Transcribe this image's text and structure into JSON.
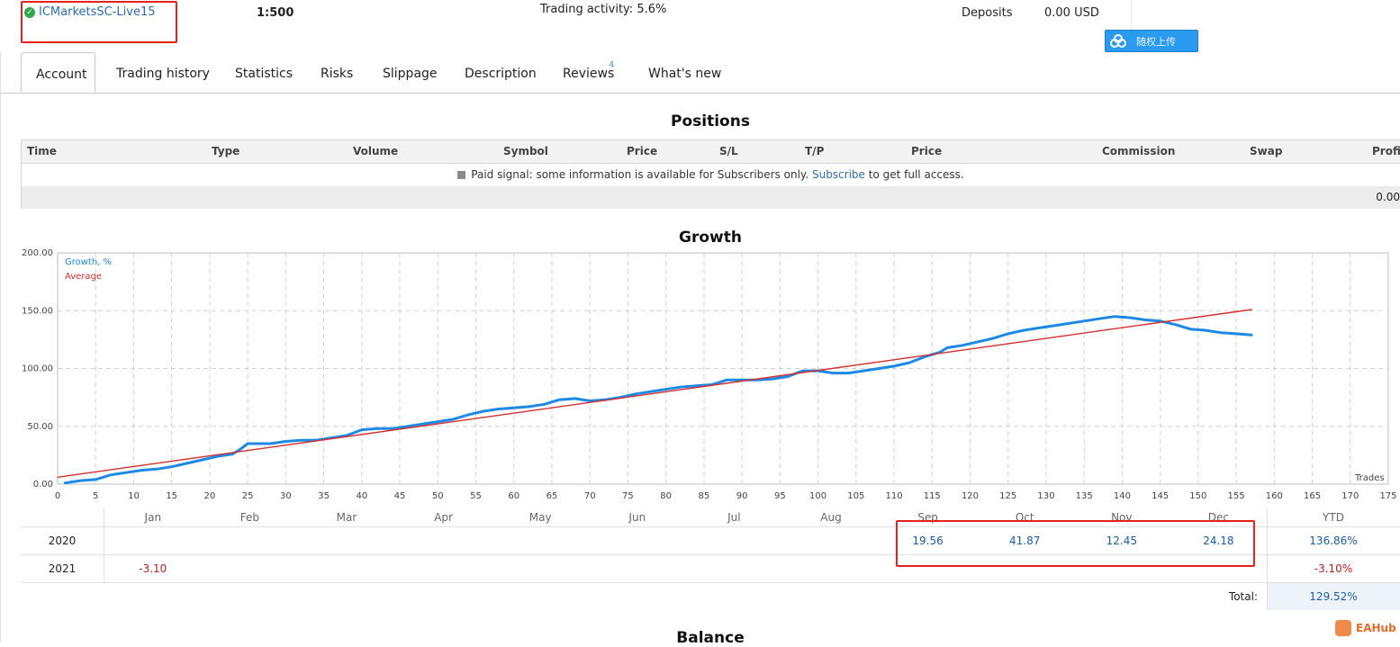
{
  "header": {
    "broker": "ICMarketsSC-Live15",
    "leverage": "1:500",
    "trading_activity": "Trading activity: 5.6%",
    "deposits_label": "Deposits",
    "deposits_value": "0.00 USD",
    "cloud_button_label": "随权上传"
  },
  "tabs": [
    {
      "label": "Account",
      "active": true
    },
    {
      "label": "Trading history"
    },
    {
      "label": "Statistics"
    },
    {
      "label": "Risks"
    },
    {
      "label": "Slippage"
    },
    {
      "label": "Description"
    },
    {
      "label": "Reviews",
      "badge": "4"
    },
    {
      "label": "What's new"
    }
  ],
  "positions": {
    "title": "Positions",
    "columns": [
      "Time",
      "Type",
      "Volume",
      "Symbol",
      "Price",
      "S/L",
      "T/P",
      "Price",
      "Commission",
      "Swap",
      "Profit"
    ],
    "notice_before": "Paid signal: some information is available for Subscribers only.",
    "notice_link": "Subscribe",
    "notice_after": "to get full access.",
    "total": "0.00"
  },
  "growth": {
    "title": "Growth",
    "legend": [
      "Growth, %",
      "Average"
    ],
    "x_axis_label": "Trades"
  },
  "chart_data": {
    "type": "line",
    "title": "Growth",
    "xlabel": "Trades",
    "ylabel": "",
    "xlim": [
      0,
      175
    ],
    "ylim": [
      0,
      200
    ],
    "x_ticks": [
      0,
      5,
      10,
      15,
      20,
      25,
      30,
      35,
      40,
      45,
      50,
      55,
      60,
      65,
      70,
      75,
      80,
      85,
      90,
      95,
      100,
      105,
      110,
      115,
      120,
      125,
      130,
      135,
      140,
      145,
      150,
      155,
      160,
      165,
      170,
      175
    ],
    "x_tick_labels": [
      "0",
      "5",
      "10",
      "15",
      "20",
      "25",
      "30",
      "35",
      "40",
      "45",
      "50",
      "55",
      "60",
      "65",
      "70",
      "75",
      "80",
      "85",
      "90",
      "95",
      "100",
      "105",
      "110",
      "115",
      "120",
      "125",
      "130",
      "135",
      "140",
      "145",
      "150",
      "155",
      "160",
      "165",
      "170",
      "175"
    ],
    "y_ticks": [
      0,
      50,
      100,
      150,
      200
    ],
    "y_tick_labels": [
      "0.00",
      "50.00",
      "100.00",
      "150.00",
      "200.00"
    ],
    "grid": true,
    "legend_position": "top-left",
    "series": [
      {
        "name": "Growth, %",
        "color": "#1e88e5",
        "x": [
          1,
          3,
          5,
          7,
          9,
          11,
          13,
          15,
          17,
          19,
          21,
          23,
          24,
          25,
          26,
          28,
          30,
          32,
          34,
          36,
          38,
          40,
          42,
          44,
          46,
          48,
          50,
          52,
          54,
          56,
          58,
          60,
          62,
          64,
          66,
          68,
          70,
          72,
          74,
          76,
          78,
          80,
          82,
          84,
          86,
          88,
          90,
          92,
          94,
          96,
          98,
          100,
          102,
          104,
          106,
          108,
          110,
          112,
          114,
          116,
          117,
          119,
          121,
          123,
          125,
          127,
          129,
          131,
          133,
          135,
          137,
          139,
          141,
          143,
          145,
          147,
          149,
          151,
          153,
          155,
          157
        ],
        "values": [
          1,
          3,
          4,
          8,
          10,
          12,
          13,
          15,
          18,
          21,
          24,
          26,
          30,
          35,
          35,
          35,
          37,
          38,
          38,
          40,
          42,
          47,
          48,
          48,
          50,
          52,
          54,
          56,
          60,
          63,
          65,
          66,
          67,
          69,
          73,
          74,
          72,
          73,
          75,
          78,
          80,
          82,
          84,
          85,
          86,
          90,
          90,
          90,
          91,
          93,
          98,
          98,
          96,
          96,
          98,
          100,
          102,
          105,
          110,
          114,
          118,
          120,
          123,
          126,
          130,
          133,
          135,
          137,
          139,
          141,
          143,
          145,
          144,
          142,
          141,
          138,
          134,
          133,
          131,
          130,
          129
        ]
      },
      {
        "name": "Average",
        "color": "#d32f2f",
        "x": [
          0,
          157
        ],
        "values": [
          6,
          151
        ]
      }
    ]
  },
  "monthly": {
    "months": [
      "Jan",
      "Feb",
      "Mar",
      "Apr",
      "May",
      "Jun",
      "Jul",
      "Aug",
      "Sep",
      "Oct",
      "Nov",
      "Dec"
    ],
    "ytd_label": "YTD",
    "rows": [
      {
        "year": "2020",
        "values": [
          "",
          "",
          "",
          "",
          "",
          "",
          "",
          "",
          "19.56",
          "41.87",
          "12.45",
          "24.18"
        ],
        "ytd": "136.86%"
      },
      {
        "year": "2021",
        "values": [
          "-3.10",
          "",
          "",
          "",
          "",
          "",
          "",
          "",
          "",
          "",
          "",
          ""
        ],
        "ytd": "-3.10%"
      }
    ],
    "total_label": "Total:",
    "total_value": "129.52%"
  },
  "balance_title": "Balance",
  "watermark": "EAHub"
}
